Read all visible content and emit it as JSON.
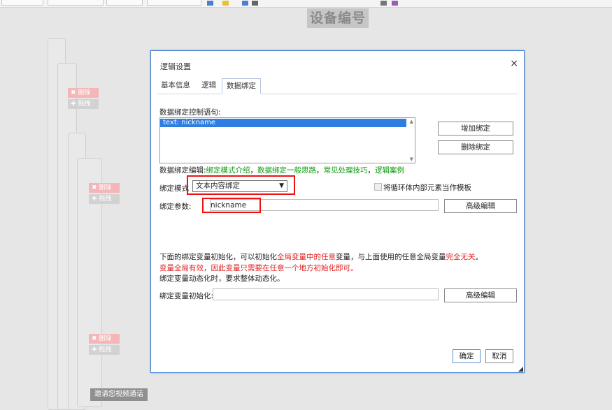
{
  "background": {
    "page_title": "设备编号",
    "chips": [
      {
        "delete": "✖ 删除",
        "move": "✚ 拖拽"
      },
      {
        "delete": "✖ 删除",
        "move": "✚ 拖拽"
      },
      {
        "delete": "✖ 删除",
        "move": "✚ 拖拽"
      }
    ],
    "video_button": "邀请您视频通话"
  },
  "dialog": {
    "title": "逻辑设置",
    "close": "×",
    "tabs": [
      {
        "label": "基本信息",
        "active": false
      },
      {
        "label": "逻辑",
        "active": false
      },
      {
        "label": "数据绑定",
        "active": true
      }
    ],
    "statement_label": "数据绑定控制语句:",
    "statements": [
      "text: nickname"
    ],
    "add_binding": "增加绑定",
    "delete_binding": "删除绑定",
    "edit_prefix": "数据绑定编辑:",
    "edit_links": [
      "绑定模式介绍",
      "数据绑定一般思路",
      "常见处理技巧",
      "逻辑案例"
    ],
    "edit_separator": "，",
    "mode_label": "绑定模式",
    "mode_value": "文本内容绑定",
    "mode_arrow": "▼",
    "loop_template_label": "将循环体内部元素当作模板",
    "param_label": "绑定参数:",
    "param_value": "nickname",
    "advanced_edit": "高级编辑",
    "init_note_1a": "下面的绑定变量初始化，可以初始化",
    "init_note_1b": "全局变量中的任意",
    "init_note_1c": "变量，与上面使用的任意全局变量",
    "init_note_1d": "完全无关",
    "init_note_1e": "。",
    "init_note_2": "变量全局有效，因此变量只需要在任意一个地方初始化即可。",
    "init_note_3": "绑定变量动态化时，要求整体动态化。",
    "init_label": "绑定变量初始化:",
    "init_value": "",
    "advanced_edit_2": "高级编辑",
    "ok": "确定",
    "cancel": "取消"
  },
  "colors": {
    "accent": "#3c7fd6",
    "highlight_red": "#e02020",
    "link_green": "#0a9a0a",
    "selection_blue": "#2f7de1"
  }
}
